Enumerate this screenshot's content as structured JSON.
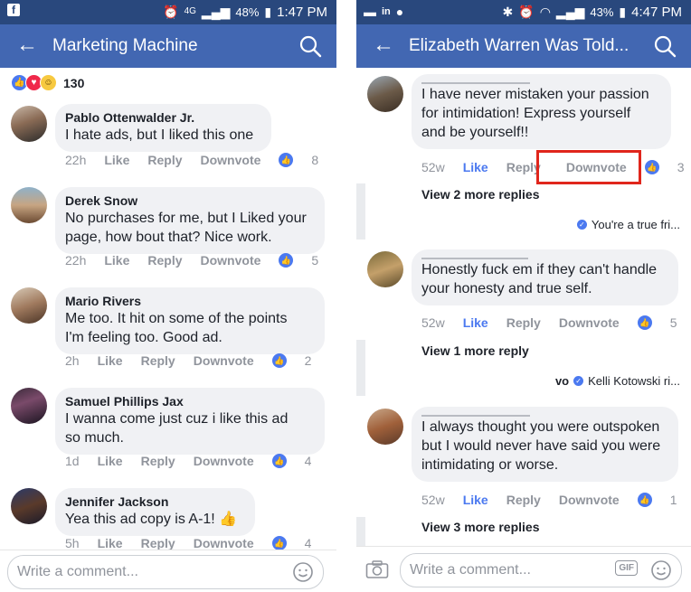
{
  "left": {
    "status": {
      "time": "1:47 PM",
      "battery": "48%",
      "network": "4G"
    },
    "title": "Marketing Machine",
    "reaction_count": "130",
    "comments": [
      {
        "name": "Pablo Ottenwalder Jr.",
        "lines": [
          "I hate ads, but I liked this one"
        ],
        "time": "22h",
        "like": "Like",
        "reply": "Reply",
        "downvote": "Downvote",
        "likes": "8"
      },
      {
        "name": "Derek Snow",
        "lines": [
          "No purchases for me, but I Liked your",
          "page, how bout that? Nice work."
        ],
        "time": "22h",
        "like": "Like",
        "reply": "Reply",
        "downvote": "Downvote",
        "likes": "5"
      },
      {
        "name": "Mario Rivers",
        "lines": [
          "Me too. It hit on some of the points",
          "I'm feeling too. Good ad."
        ],
        "time": "2h",
        "like": "Like",
        "reply": "Reply",
        "downvote": "Downvote",
        "likes": "2"
      },
      {
        "name": "Samuel Phillips Jax",
        "lines": [
          "I wanna come just cuz i like this ad",
          "so much."
        ],
        "time": "1d",
        "like": "Like",
        "reply": "Reply",
        "downvote": "Downvote",
        "likes": "4"
      },
      {
        "name": "Jennifer Jackson",
        "lines": [
          "Yea this ad copy is A-1! 👍"
        ],
        "time": "5h",
        "like": "Like",
        "reply": "Reply",
        "downvote": "Downvote",
        "likes": "4"
      }
    ],
    "composer_placeholder": "Write a comment..."
  },
  "right": {
    "status": {
      "time": "4:47 PM",
      "battery": "43%"
    },
    "title": "Elizabeth Warren Was Told...",
    "comments": [
      {
        "lines": [
          "I have never mistaken your passion",
          "for intimidation! Express yourself",
          "and be yourself!!"
        ],
        "time": "52w",
        "like": "Like",
        "reply": "Reply",
        "downvote": "Downvote",
        "likes": "3",
        "view_more": "View 2 more replies",
        "preview": "You're a true fri..."
      },
      {
        "lines": [
          "Honestly fuck em if they can't handle",
          "your honesty and true self."
        ],
        "time": "52w",
        "like": "Like",
        "reply": "Reply",
        "downvote": "Downvote",
        "likes": "5",
        "view_more": "View 1 more reply",
        "preview_lead": "vo",
        "preview": "Kelli Kotowski ri..."
      },
      {
        "lines": [
          "I always thought you were outspoken",
          "but I would never have said you were",
          "intimidating or worse."
        ],
        "time": "52w",
        "like": "Like",
        "reply": "Reply",
        "downvote": "Downvote",
        "likes": "1",
        "view_more": "View 3 more replies"
      }
    ],
    "composer_placeholder": "Write a comment...",
    "gif_label": "GIF"
  },
  "colors": {
    "appbar": "#4267b2",
    "statusbar": "#29487d",
    "like_blue": "#4b79f0",
    "highlight": "#e0261c"
  }
}
